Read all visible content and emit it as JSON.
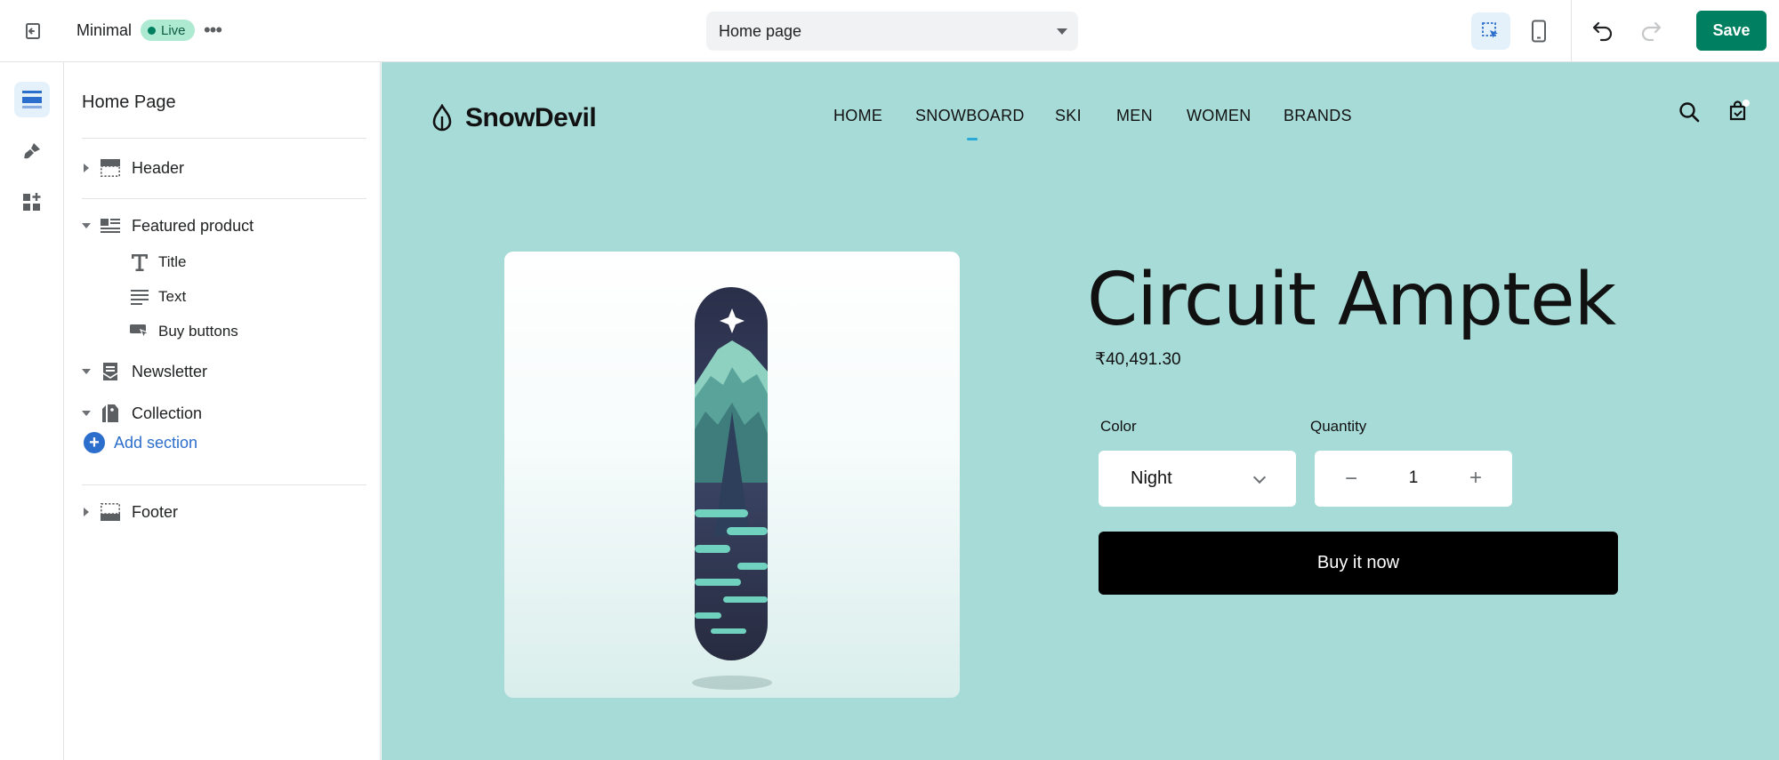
{
  "topbar": {
    "theme_name": "Minimal",
    "status_badge": "Live",
    "more_label": "•••",
    "page_selector": "Home page",
    "save_label": "Save",
    "colors": {
      "save": "#008060",
      "badge_bg": "#aee9d1"
    }
  },
  "rail": {
    "items": [
      {
        "icon": "sections-icon",
        "active": true
      },
      {
        "icon": "theme-settings-icon",
        "active": false
      },
      {
        "icon": "app-embeds-icon",
        "active": false
      }
    ]
  },
  "sidebar": {
    "title": "Home Page",
    "sections": {
      "header": "Header",
      "featured_product": "Featured product",
      "featured_blocks": [
        "Title",
        "Text",
        "Buy buttons"
      ],
      "newsletter": "Newsletter",
      "collection": "Collection",
      "add_section": "Add section",
      "footer": "Footer"
    }
  },
  "preview": {
    "brand": "SnowDevil",
    "nav": [
      "HOME",
      "SNOWBOARD",
      "SKI",
      "MEN",
      "WOMEN",
      "BRANDS"
    ],
    "product": {
      "title": "Circuit Amptek",
      "price": "₹40,491.30",
      "color_label": "Color",
      "color_value": "Night",
      "quantity_label": "Quantity",
      "quantity_value": "1",
      "buy_label": "Buy it now"
    },
    "background": "#a7dbd8"
  }
}
